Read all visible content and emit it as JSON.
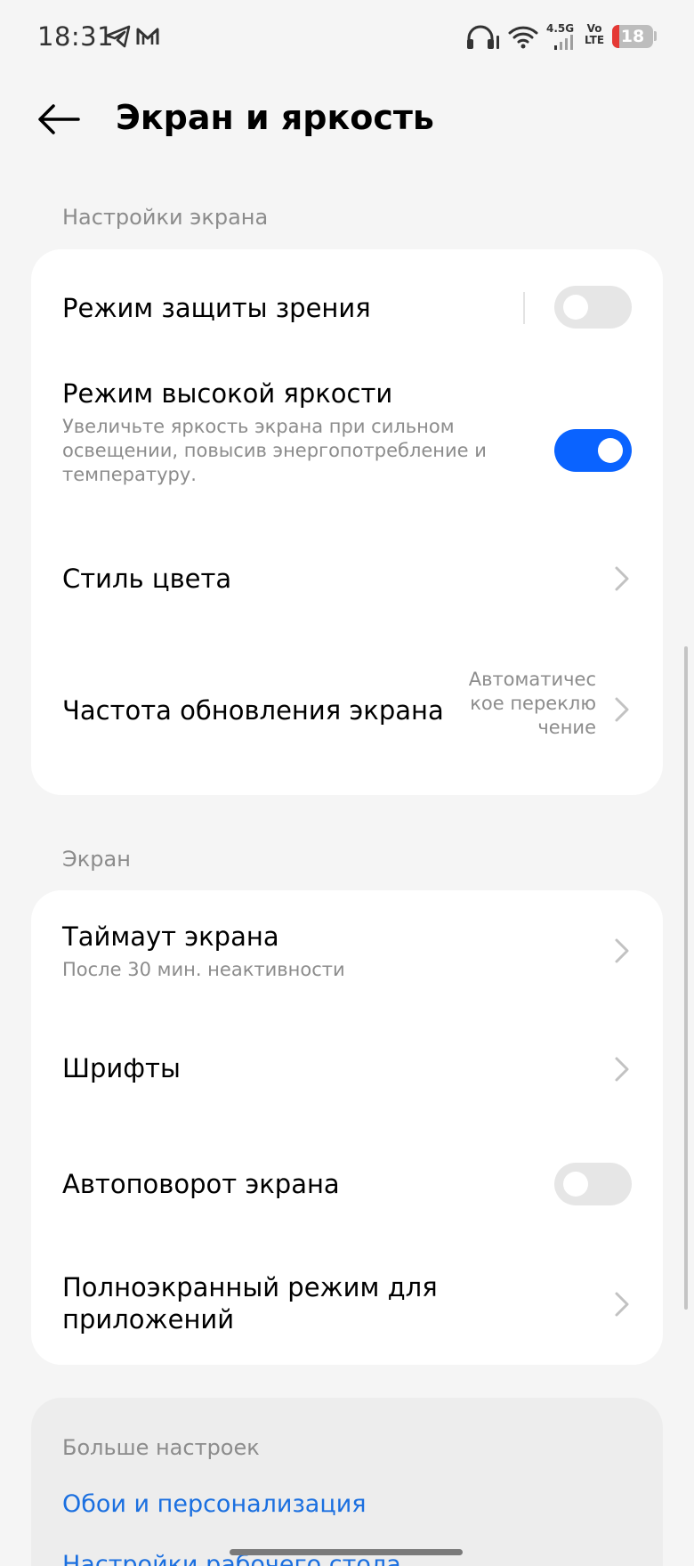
{
  "status_bar": {
    "time": "18:31",
    "network_type": "4.5G",
    "volte_top": "Vo",
    "volte_bottom": "LTE",
    "battery_level": "18",
    "battery_fraction": 0.18,
    "icons": [
      "telegram-icon",
      "mail-icon",
      "headphones-icon",
      "wifi-icon",
      "signal-icon",
      "battery-icon"
    ]
  },
  "header": {
    "title": "Экран и яркость"
  },
  "section_display_settings": {
    "label": "Настройки экрана",
    "items": [
      {
        "title": "Режим защиты зрения",
        "control": "toggle",
        "state": "off"
      },
      {
        "title": "Режим высокой яркости",
        "subtitle": "Увеличьте яркость экрана при сильном освещении, повысив энергопотребление и температуру.",
        "control": "toggle",
        "state": "on"
      },
      {
        "title": "Стиль цвета",
        "control": "chevron"
      },
      {
        "title": "Частота обновления экрана",
        "value": "Автоматическое переключение",
        "control": "chevron"
      }
    ]
  },
  "section_screen": {
    "label": "Экран",
    "items": [
      {
        "title": "Таймаут экрана",
        "subtitle": "После 30 мин. неактивности",
        "control": "chevron"
      },
      {
        "title": "Шрифты",
        "control": "chevron"
      },
      {
        "title": "Автоповорот экрана",
        "control": "toggle",
        "state": "off"
      },
      {
        "title": "Полноэкранный режим для приложений",
        "control": "chevron"
      }
    ]
  },
  "more_settings": {
    "label": "Больше настроек",
    "links": [
      {
        "label": "Обои и персонализация"
      },
      {
        "label": "Настройки рабочего стола"
      }
    ]
  },
  "colors": {
    "accent": "#0a63ff",
    "link": "#1a6fe0",
    "background": "#f5f5f5",
    "card": "#ffffff",
    "secondary_text": "#8c8c8c"
  }
}
